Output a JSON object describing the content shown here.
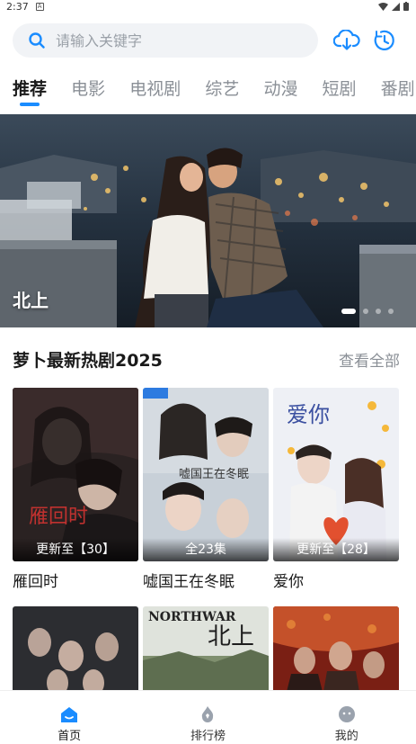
{
  "status_bar": {
    "time": "2:37"
  },
  "search": {
    "placeholder": "请输入关键字"
  },
  "tabs": [
    {
      "label": "推荐",
      "active": true
    },
    {
      "label": "电影"
    },
    {
      "label": "电视剧"
    },
    {
      "label": "综艺"
    },
    {
      "label": "动漫"
    },
    {
      "label": "短剧"
    },
    {
      "label": "番剧"
    }
  ],
  "banner": {
    "title": "北上",
    "slide_count": 4,
    "active_slide": 1
  },
  "section": {
    "title": "萝卜最新热剧2025",
    "see_all": "查看全部",
    "items": [
      {
        "title": "雁回时",
        "badge": "更新至【30】"
      },
      {
        "title": "嘘国王在冬眠",
        "badge": "全23集"
      },
      {
        "title": "爱你",
        "badge": "更新至【28】"
      },
      {
        "title": "",
        "badge": ""
      },
      {
        "title": "",
        "badge": ""
      },
      {
        "title": "",
        "badge": ""
      }
    ]
  },
  "bottom_nav": [
    {
      "label": "首页",
      "icon": "home-icon",
      "active": true
    },
    {
      "label": "排行榜",
      "icon": "ranking-icon"
    },
    {
      "label": "我的",
      "icon": "profile-icon"
    }
  ],
  "colors": {
    "accent": "#1a8cff",
    "inactive_tab": "#8a8f96"
  }
}
